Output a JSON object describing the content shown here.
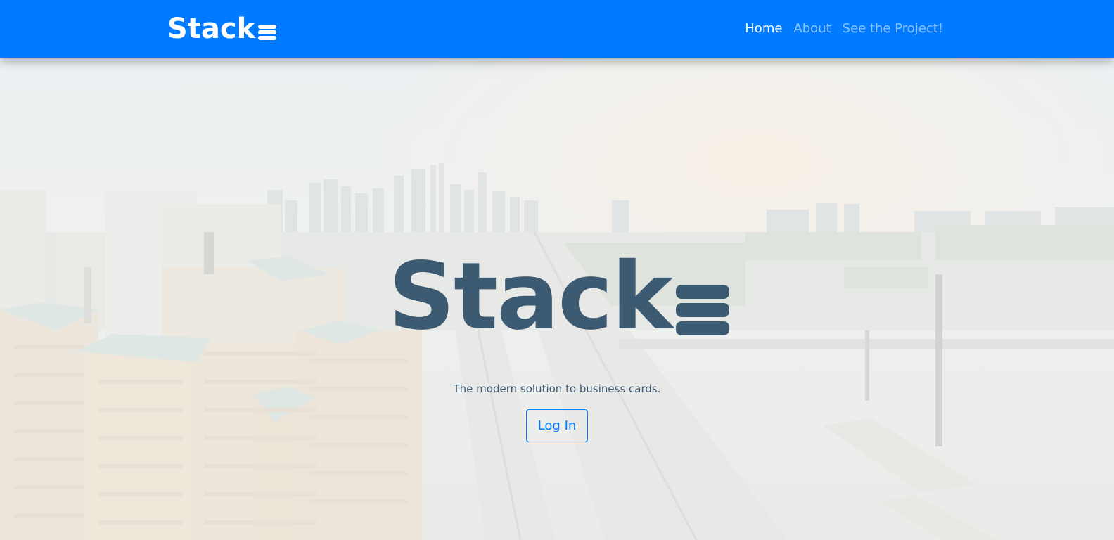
{
  "navbar": {
    "brand": "Stack",
    "brand_icon": "stack-icon",
    "links": [
      {
        "label": "Home",
        "active": true
      },
      {
        "label": "About",
        "active": false
      },
      {
        "label": "See the Project!",
        "active": false
      }
    ],
    "background_color": "#007bff"
  },
  "hero": {
    "logo_text": "Stack",
    "logo_icon": "stack-icon",
    "tagline": "The modern solution to business cards.",
    "login_button_label": "Log In",
    "text_color": "#3d5a73",
    "background_image": "city-skyline-image"
  }
}
